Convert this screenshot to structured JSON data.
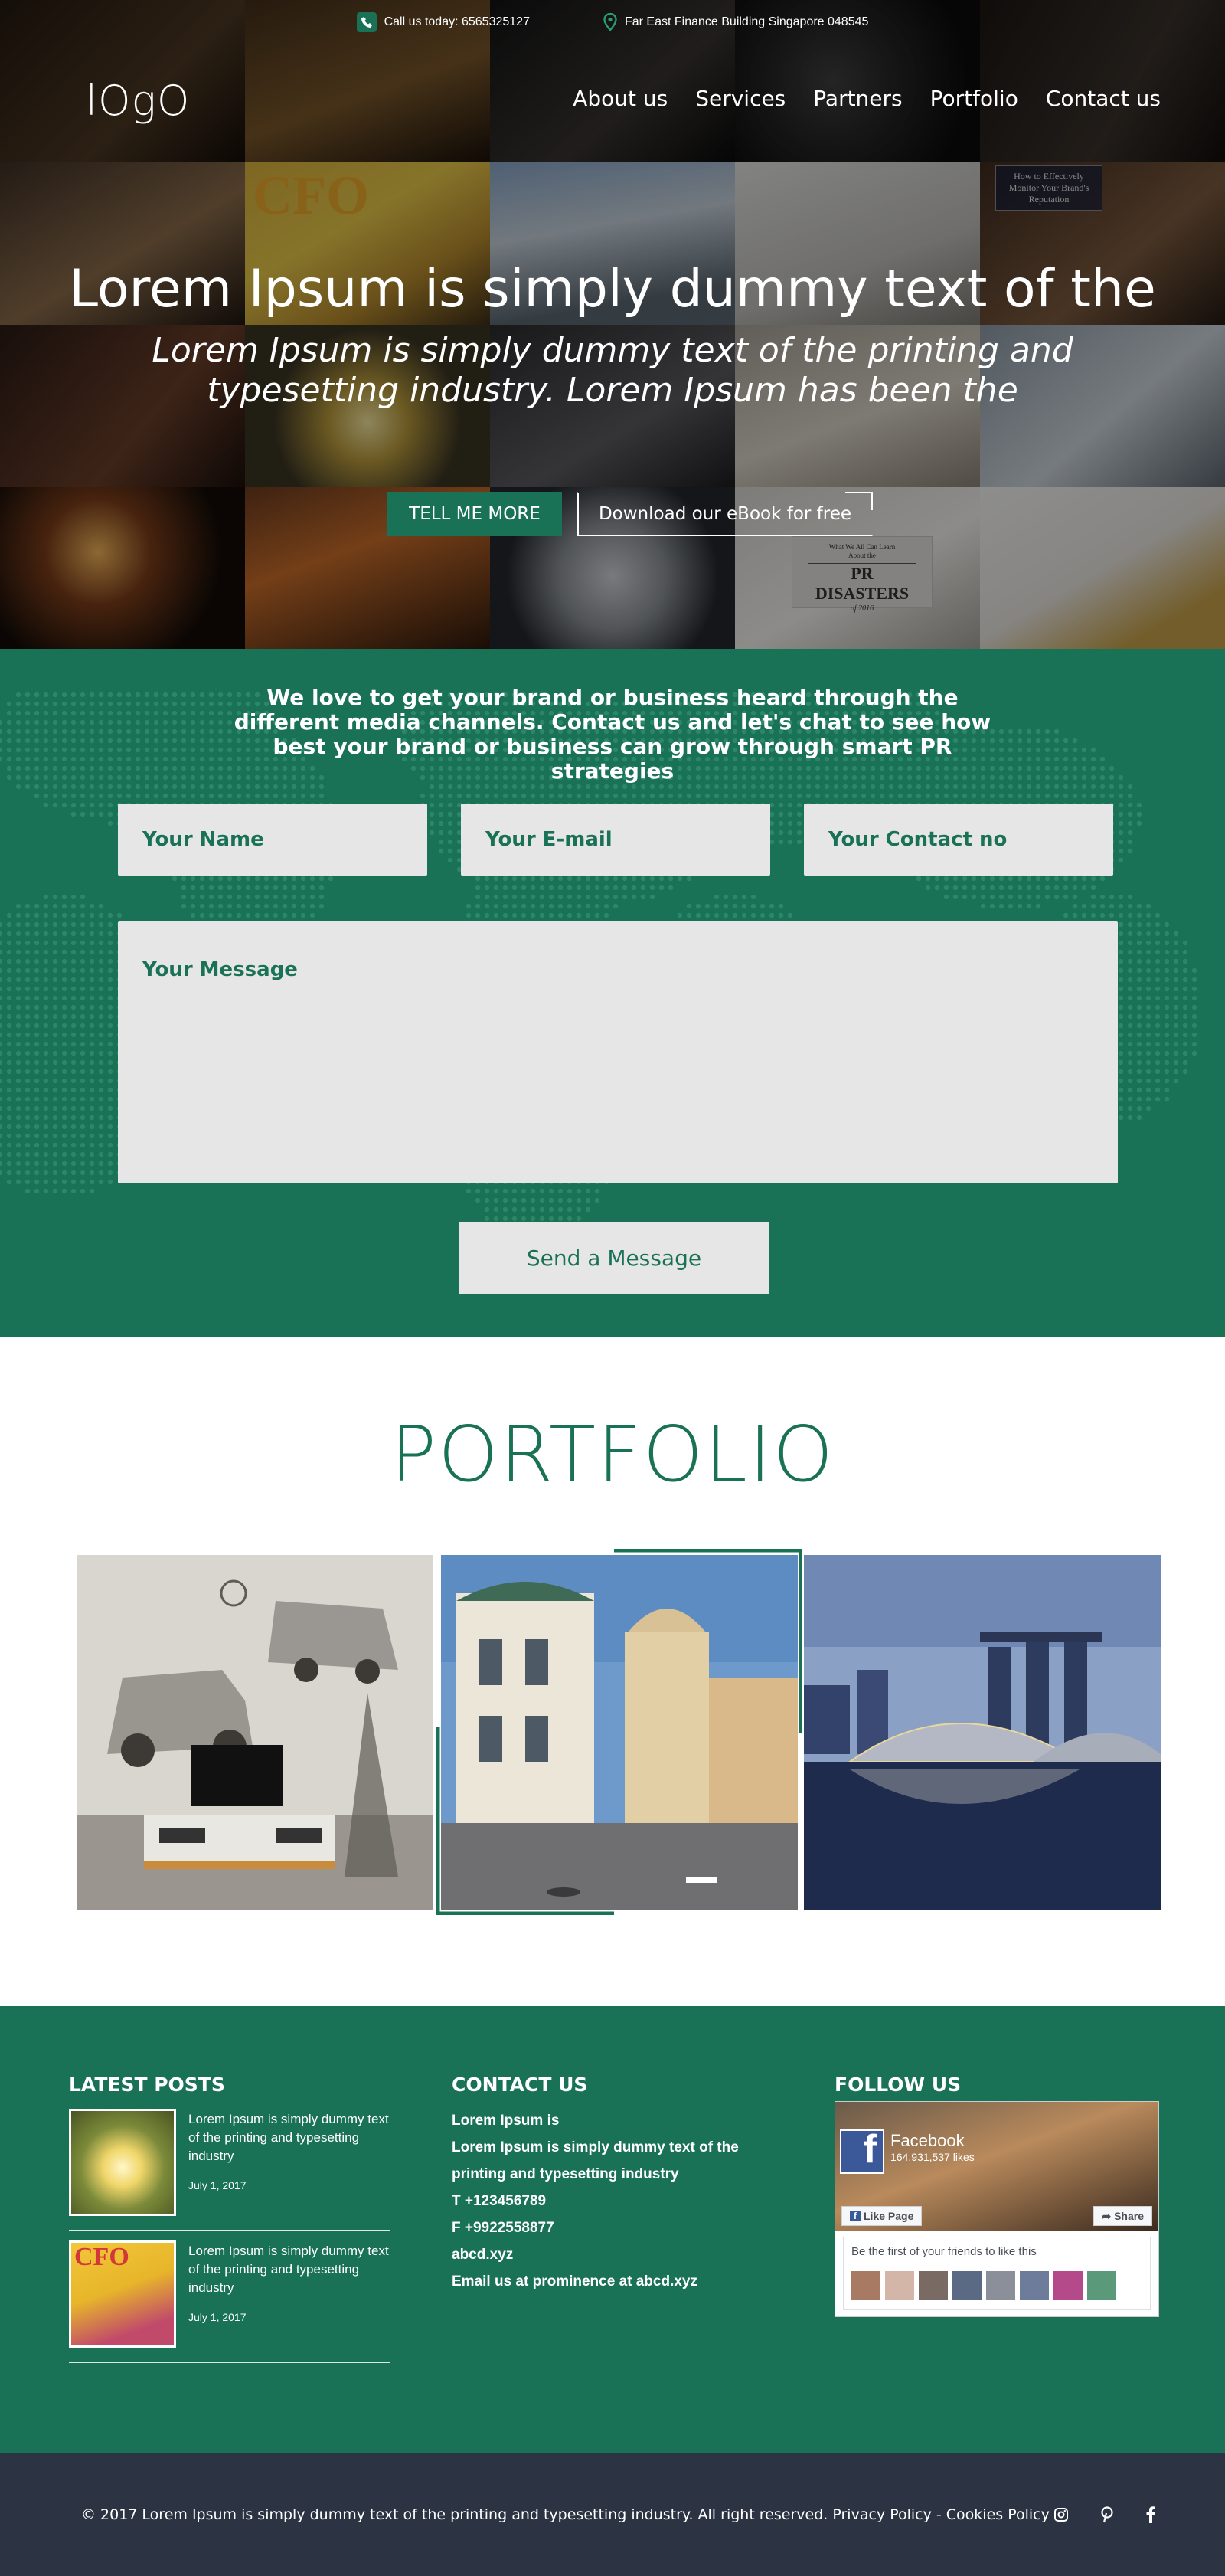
{
  "header": {
    "phone_text": "Call us today: 6565325127",
    "address_text": "Far East Finance Building Singapore 048545",
    "logo": "lOgO",
    "nav": [
      {
        "label": "About us"
      },
      {
        "label": "Services"
      },
      {
        "label": "Partners"
      },
      {
        "label": "Portfolio"
      },
      {
        "label": "Contact us"
      }
    ]
  },
  "hero": {
    "title": "Lorem Ipsum is simply dummy text of the",
    "subtitle": "Lorem Ipsum is simply dummy text of the printing and typesetting industry. Lorem Ipsum has been the",
    "btn_more": "TELL ME MORE",
    "btn_ebook": "Download our eBook for free",
    "image_texts": {
      "magazine": "CFO",
      "tablet_caption": "How to Effectively Monitor Your Brand's Reputation",
      "book_small": "What We All Can Learn About the",
      "book_title": "PR DISASTERS",
      "book_sub": "of 2016"
    }
  },
  "contact": {
    "intro": "We love to get your brand or business heard through the different media channels. Contact us and let's chat to see how best your brand or business can grow through smart PR strategies",
    "name_placeholder": "Your Name",
    "email_placeholder": "Your E-mail",
    "phone_placeholder": "Your Contact no",
    "message_placeholder": "Your Message",
    "send_label": "Send a Message"
  },
  "portfolio": {
    "title": "PORTFOLIO"
  },
  "footer": {
    "latest_posts_title": "LATEST POSTS",
    "posts": [
      {
        "text": "Lorem Ipsum is simply dummy text of the printing and typesetting industry",
        "date": "July 1, 2017"
      },
      {
        "text": "Lorem Ipsum is simply dummy text of the printing and typesetting industry",
        "date": "July 1, 2017",
        "thumb_text": "CFO"
      }
    ],
    "contact_title": "CONTACT US",
    "contact_lines": [
      "Lorem Ipsum is",
      "Lorem Ipsum is simply dummy text of the printing and typesetting industry",
      "T +123456789",
      "F +9922558877",
      "abcd.xyz",
      "Email us at prominence at abcd.xyz"
    ],
    "follow_title": "FOLLOW US",
    "facebook": {
      "name": "Facebook",
      "likes": "164,931,537 likes",
      "like_btn": "Like Page",
      "share_btn": "Share",
      "friends_text": "Be the first of your friends to like this"
    }
  },
  "bottombar": {
    "copyright": "© 2017 Lorem Ipsum is simply dummy text of the printing and typesetting industry. All right reserved. Privacy Policy - Cookies Policy",
    "social_icons": [
      "instagram-icon",
      "pinterest-icon",
      "facebook-icon"
    ]
  },
  "colors": {
    "brand_green": "#197156",
    "input_bg": "#e6e6e6",
    "bottombar_bg": "#2c3444",
    "facebook_blue": "#3b5998"
  }
}
